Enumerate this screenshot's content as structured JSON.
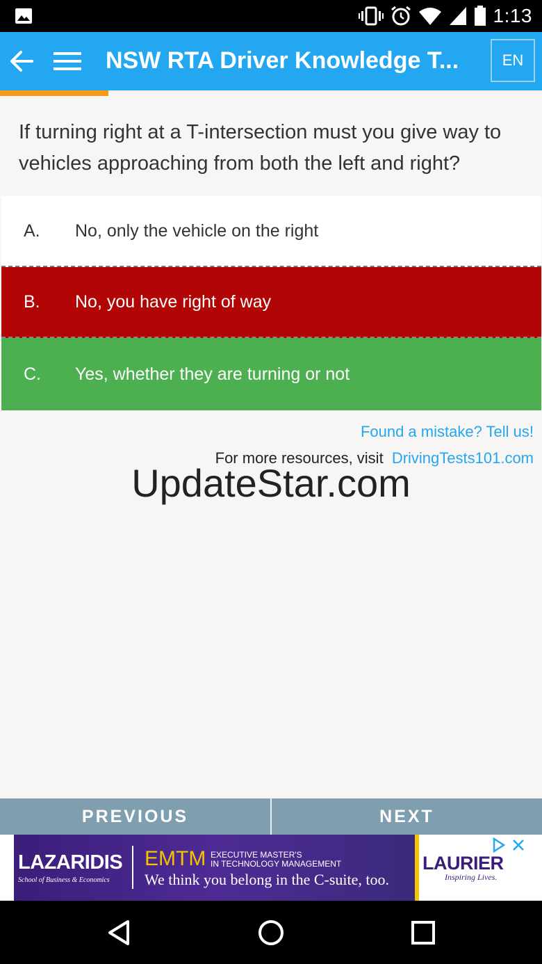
{
  "status_bar": {
    "time": "1:13"
  },
  "app_bar": {
    "title": "NSW RTA Driver Knowledge T...",
    "language": "EN"
  },
  "progress": {
    "fraction": 0.2
  },
  "question": {
    "text": "If turning right at a T-intersection must you give way to vehicles approaching from both the left and right?"
  },
  "answers": [
    {
      "letter": "A.",
      "text": "No, only the vehicle on the right",
      "state": "neutral"
    },
    {
      "letter": "B.",
      "text": "No, you have right of way",
      "state": "wrong"
    },
    {
      "letter": "C.",
      "text": "Yes, whether they are turning or not",
      "state": "correct"
    }
  ],
  "footer_links": {
    "mistake": "Found a mistake? Tell us!",
    "resources_prefix": "For more resources, visit",
    "resources_link": "DrivingTests101.com"
  },
  "watermark": "UpdateStar.com",
  "nav": {
    "previous": "PREVIOUS",
    "next": "NEXT"
  },
  "ad": {
    "brand": "LAZARIDIS",
    "brand_sub": "School of Business & Economics",
    "program": "EMTM",
    "program_sub1": "EXECUTIVE MASTER'S",
    "program_sub2": "IN TECHNOLOGY MANAGEMENT",
    "tagline": "We think you belong in the C-suite, too.",
    "university": "LAURIER",
    "university_sub": "Inspiring Lives."
  },
  "colors": {
    "accent": "#22a7f0",
    "progress": "#f59a1b",
    "wrong": "#b20606",
    "correct": "#4caf50",
    "nav": "#7f9fb0"
  }
}
